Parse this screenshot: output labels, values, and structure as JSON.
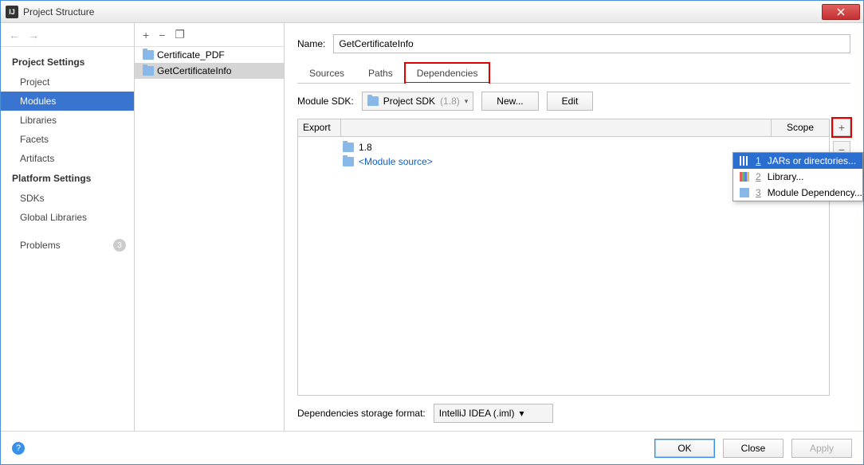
{
  "window": {
    "title": "Project Structure"
  },
  "sidebar": {
    "section1": "Project Settings",
    "items1": [
      "Project",
      "Modules",
      "Libraries",
      "Facets",
      "Artifacts"
    ],
    "section2": "Platform Settings",
    "items2": [
      "SDKs",
      "Global Libraries"
    ],
    "problems": "Problems",
    "problems_count": "3"
  },
  "tree": {
    "items": [
      "Certificate_PDF",
      "GetCertificateInfo"
    ]
  },
  "main": {
    "name_label": "Name:",
    "name_value": "GetCertificateInfo",
    "tabs": [
      "Sources",
      "Paths",
      "Dependencies"
    ],
    "sdk_label": "Module SDK:",
    "sdk_value": "Project SDK",
    "sdk_version": "(1.8)",
    "new_btn": "New...",
    "edit_btn": "Edit",
    "header_export": "Export",
    "header_scope": "Scope",
    "dep_rows": [
      {
        "label": "1.8",
        "blue": false
      },
      {
        "label": "<Module source>",
        "blue": true
      }
    ],
    "storage_label": "Dependencies storage format:",
    "storage_value": "IntelliJ IDEA (.iml)"
  },
  "popup": {
    "items": [
      {
        "num": "1",
        "label": "JARs or directories..."
      },
      {
        "num": "2",
        "label": "Library..."
      },
      {
        "num": "3",
        "label": "Module Dependency..."
      }
    ]
  },
  "footer": {
    "ok": "OK",
    "close": "Close",
    "apply": "Apply"
  }
}
